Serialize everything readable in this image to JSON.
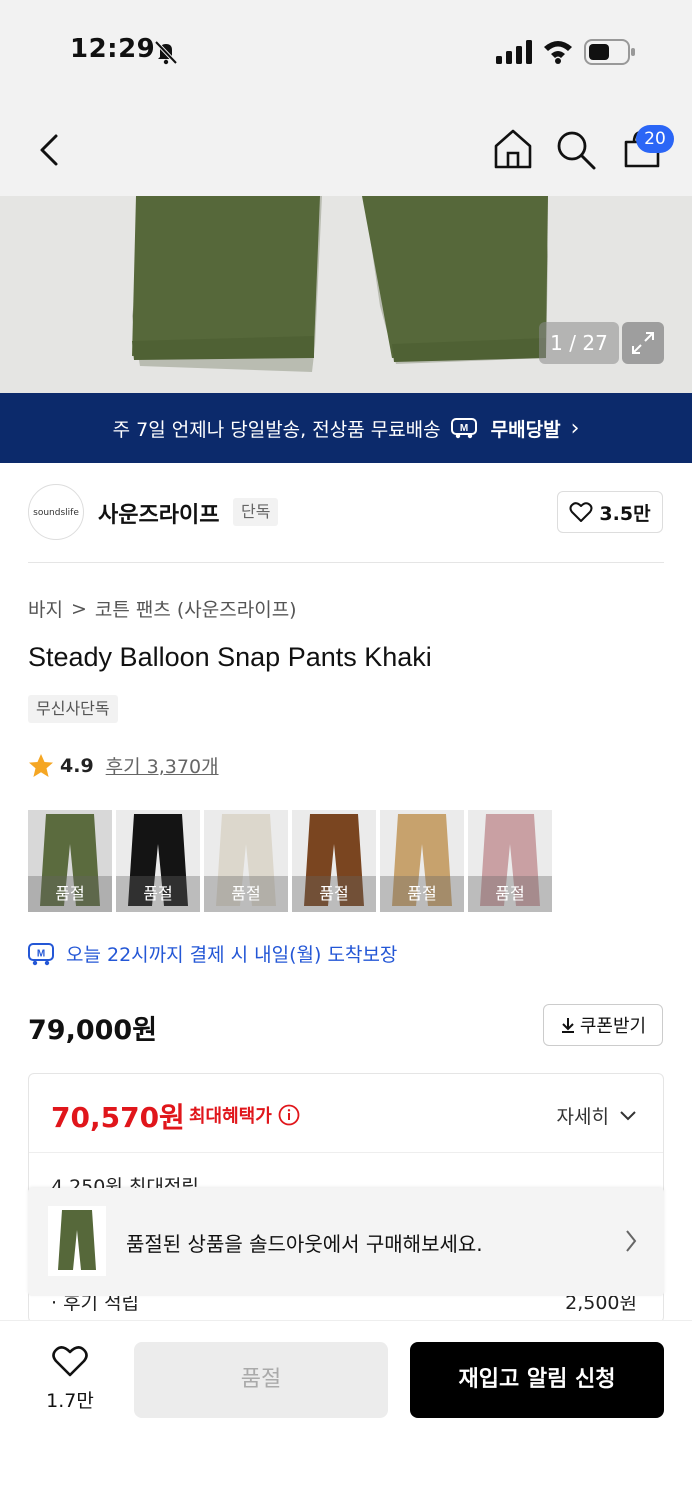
{
  "status_bar": {
    "time": "12:29"
  },
  "nav": {
    "cart_count": "20"
  },
  "hero": {
    "counter": "1 / 27"
  },
  "banner": {
    "text": "주 7일 언제나 당일발송, 전상품 무료배송",
    "badge": "무배당발",
    "chevron": "›"
  },
  "brand": {
    "logo_text": "soundslife",
    "name": "사운즈라이프",
    "tag": "단독",
    "likes": "3.5만"
  },
  "breadcrumb": {
    "category": "바지",
    "separator": ">",
    "subcategory": "코튼 팬츠 (사운즈라이프)"
  },
  "product": {
    "title": "Steady Balloon Snap Pants Khaki",
    "tag": "무신사단독"
  },
  "rating": {
    "score": "4.9",
    "reviews": "후기 3,370개"
  },
  "swatches": [
    {
      "label": "품절",
      "color": "#5b6b3e"
    },
    {
      "label": "품절",
      "color": "#141414"
    },
    {
      "label": "품절",
      "color": "#dcd7cc"
    },
    {
      "label": "품절",
      "color": "#7a4520"
    },
    {
      "label": "품절",
      "color": "#c7a26d"
    },
    {
      "label": "품절",
      "color": "#c9a0a3"
    }
  ],
  "delivery": {
    "text": "오늘 22시까지 결제 시 내일(월) 도착보장"
  },
  "price": {
    "original": "79,000원",
    "coupon_label": "쿠폰받기"
  },
  "benefit": {
    "price": "70,570원",
    "label": "최대혜택가",
    "detail": "자세히",
    "points": "4,250원 최대적립",
    "row_label": "· 후기 적립",
    "row_value": "2,500원"
  },
  "toast": {
    "text": "품절된 상품을 솔드아웃에서 구매해보세요."
  },
  "bottom": {
    "wish_count": "1.7만",
    "soldout": "품절",
    "restock": "재입고 알림 신청"
  },
  "colors": {
    "accent_blue": "#2b66f6",
    "banner_bg": "#0c2a6b",
    "sale_red": "#e0161b"
  }
}
